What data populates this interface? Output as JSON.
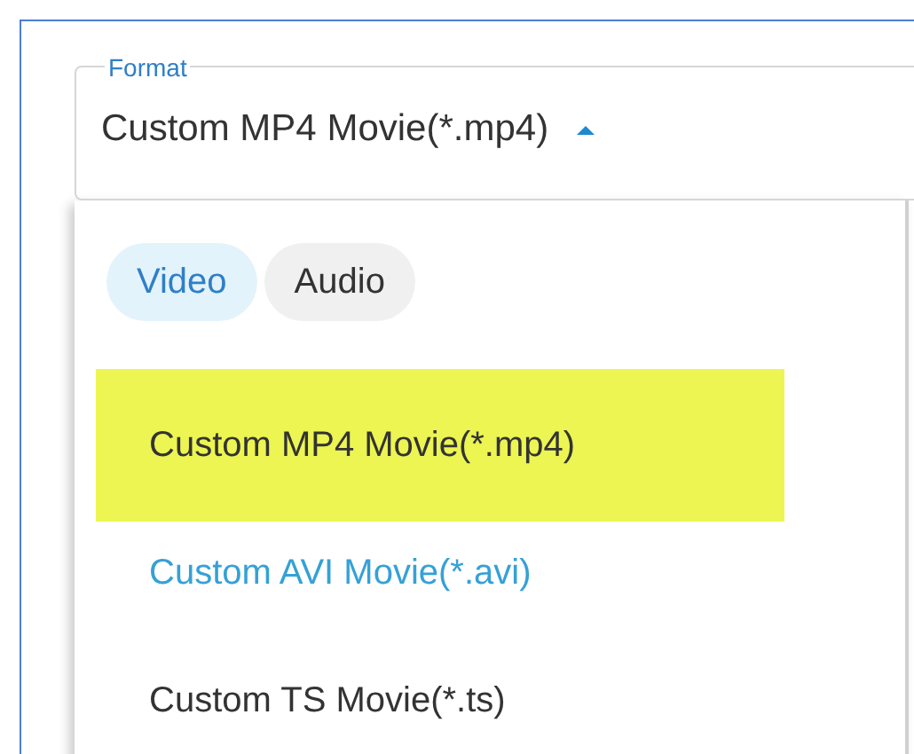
{
  "format_field": {
    "label": "Format",
    "value": "Custom MP4 Movie(*.mp4)",
    "expanded": true
  },
  "dropdown": {
    "tabs": [
      {
        "label": "Video",
        "selected": true
      },
      {
        "label": "Audio",
        "selected": false
      }
    ],
    "items": [
      {
        "label": "Custom MP4 Movie(*.mp4)",
        "selected": true,
        "hovered": false
      },
      {
        "label": "Custom AVI Movie(*.avi)",
        "selected": false,
        "hovered": true
      },
      {
        "label": "Custom TS Movie(*.ts)",
        "selected": false,
        "hovered": false
      }
    ]
  }
}
